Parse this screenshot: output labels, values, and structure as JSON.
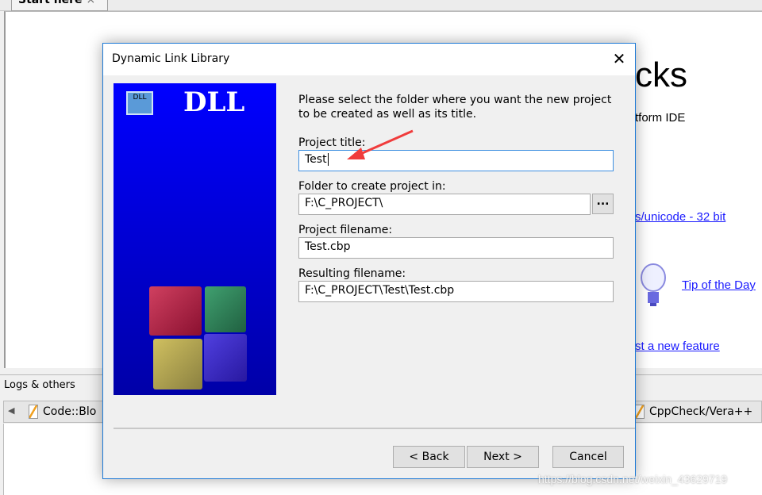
{
  "ide": {
    "tab_label": "Start here",
    "tab_close": "×",
    "start_page": {
      "heading_fragment": "cks",
      "subtitle_fragment": "tform IDE",
      "link_unicode": "s/unicode - 32 bit",
      "link_tip": "Tip of the Day",
      "link_feature": "st a new feature "
    },
    "logs": {
      "title": "Logs & others",
      "tabs": [
        {
          "label": "Code::Blo"
        },
        {
          "label": "CppCheck/Vera++"
        }
      ]
    }
  },
  "dialog": {
    "title": "Dynamic Link Library",
    "close": "✕",
    "banner_text": "DLL",
    "banner_icon_text": "DLL",
    "intro": "Please select the folder where you want the new project to be created as well as its title.",
    "fields": {
      "project_title": {
        "label": "Project title:",
        "value": "Test"
      },
      "folder": {
        "label": "Folder to create project in:",
        "value": "F:\\C_PROJECT\\",
        "browse": "..."
      },
      "project_filename": {
        "label": "Project filename:",
        "value": "Test.cbp"
      },
      "resulting_filename": {
        "label": "Resulting filename:",
        "value": "F:\\C_PROJECT\\Test\\Test.cbp"
      }
    },
    "buttons": {
      "back": "< Back",
      "next": "Next >",
      "cancel": "Cancel"
    }
  },
  "annotation": {
    "arrow_color": "#f03c3c"
  },
  "watermark": "https://blog.csdn.net/weixin_43629719"
}
